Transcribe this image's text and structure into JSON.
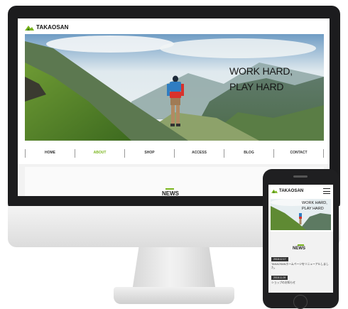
{
  "site": {
    "logo_text": "TAKAOSAN",
    "hero_line1": "WORK HARD,",
    "hero_line2": "PLAY HARD",
    "nav": [
      {
        "label": "HOME",
        "active": false
      },
      {
        "label": "ABOUT",
        "active": true
      },
      {
        "label": "SHOP",
        "active": false
      },
      {
        "label": "ACCESS",
        "active": false
      },
      {
        "label": "BLOG",
        "active": false
      },
      {
        "label": "CONTACT",
        "active": false
      }
    ],
    "news_title": "NEWS",
    "accent_color": "#7ab51d"
  },
  "mobile": {
    "logo_text": "TAKAOSAN",
    "hero_line1": "WORK HARD,",
    "hero_line2": "PLAY HARD",
    "menu_icon": "hamburger-icon",
    "news_title": "NEWS",
    "news": [
      {
        "date": "2018.12.17",
        "text": "TAKAOSANホームページをリニューアルしました。"
      },
      {
        "date": "2018.11.09",
        "text": "ショップのお知らせ"
      }
    ]
  }
}
